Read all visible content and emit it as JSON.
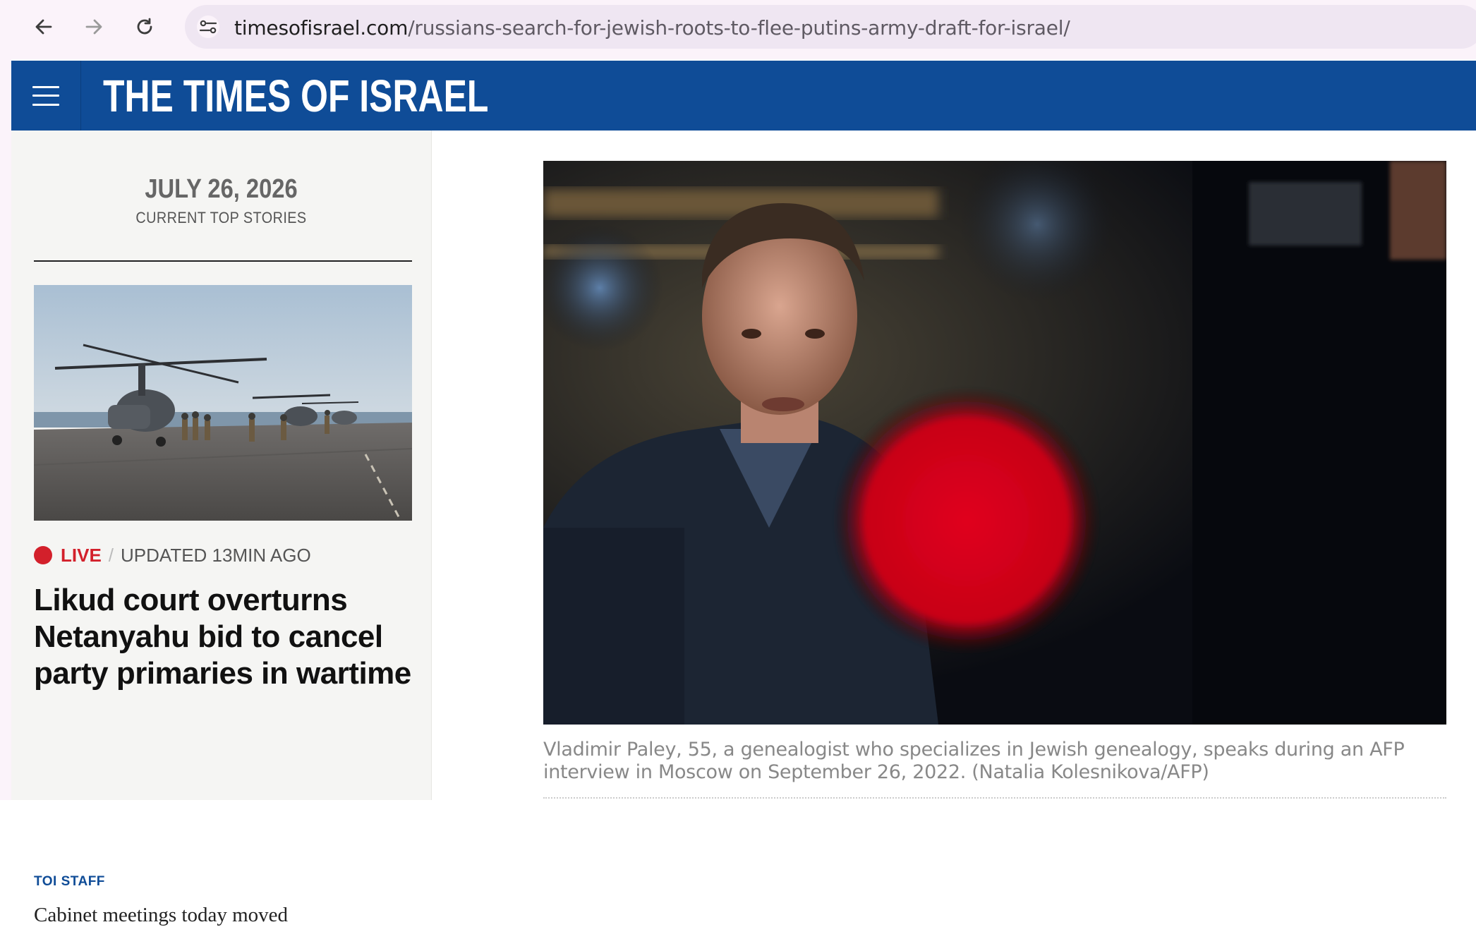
{
  "browser": {
    "url_host": "timesofisrael.com",
    "url_path": "/russians-search-for-jewish-roots-to-flee-putins-army-draft-for-israel/",
    "back_icon": "arrow-left-icon",
    "forward_icon": "arrow-right-icon",
    "reload_icon": "reload-icon",
    "site_info_icon": "tune-icon"
  },
  "masthead": {
    "logo": "THE TIMES OF ISRAEL",
    "menu_icon": "hamburger-menu-icon",
    "color": "#0f4c97"
  },
  "sidebar": {
    "date": "JULY 26, 2026",
    "subtitle": "CURRENT TOP STORIES",
    "story": {
      "live_label": "LIVE",
      "separator": "/",
      "updated": "UPDATED 13MIN AGO",
      "headline": "Likud court overturns Netanyahu bid to cancel party primaries in wartime",
      "byline": "TOI STAFF",
      "teaser": "Cabinet meetings today moved"
    }
  },
  "article": {
    "caption": "Vladimir Paley, 55, a genealogist who specializes in Jewish genealogy, speaks during an AFP interview in Moscow on September 26, 2022. (Natalia Kolesnikova/AFP)"
  }
}
